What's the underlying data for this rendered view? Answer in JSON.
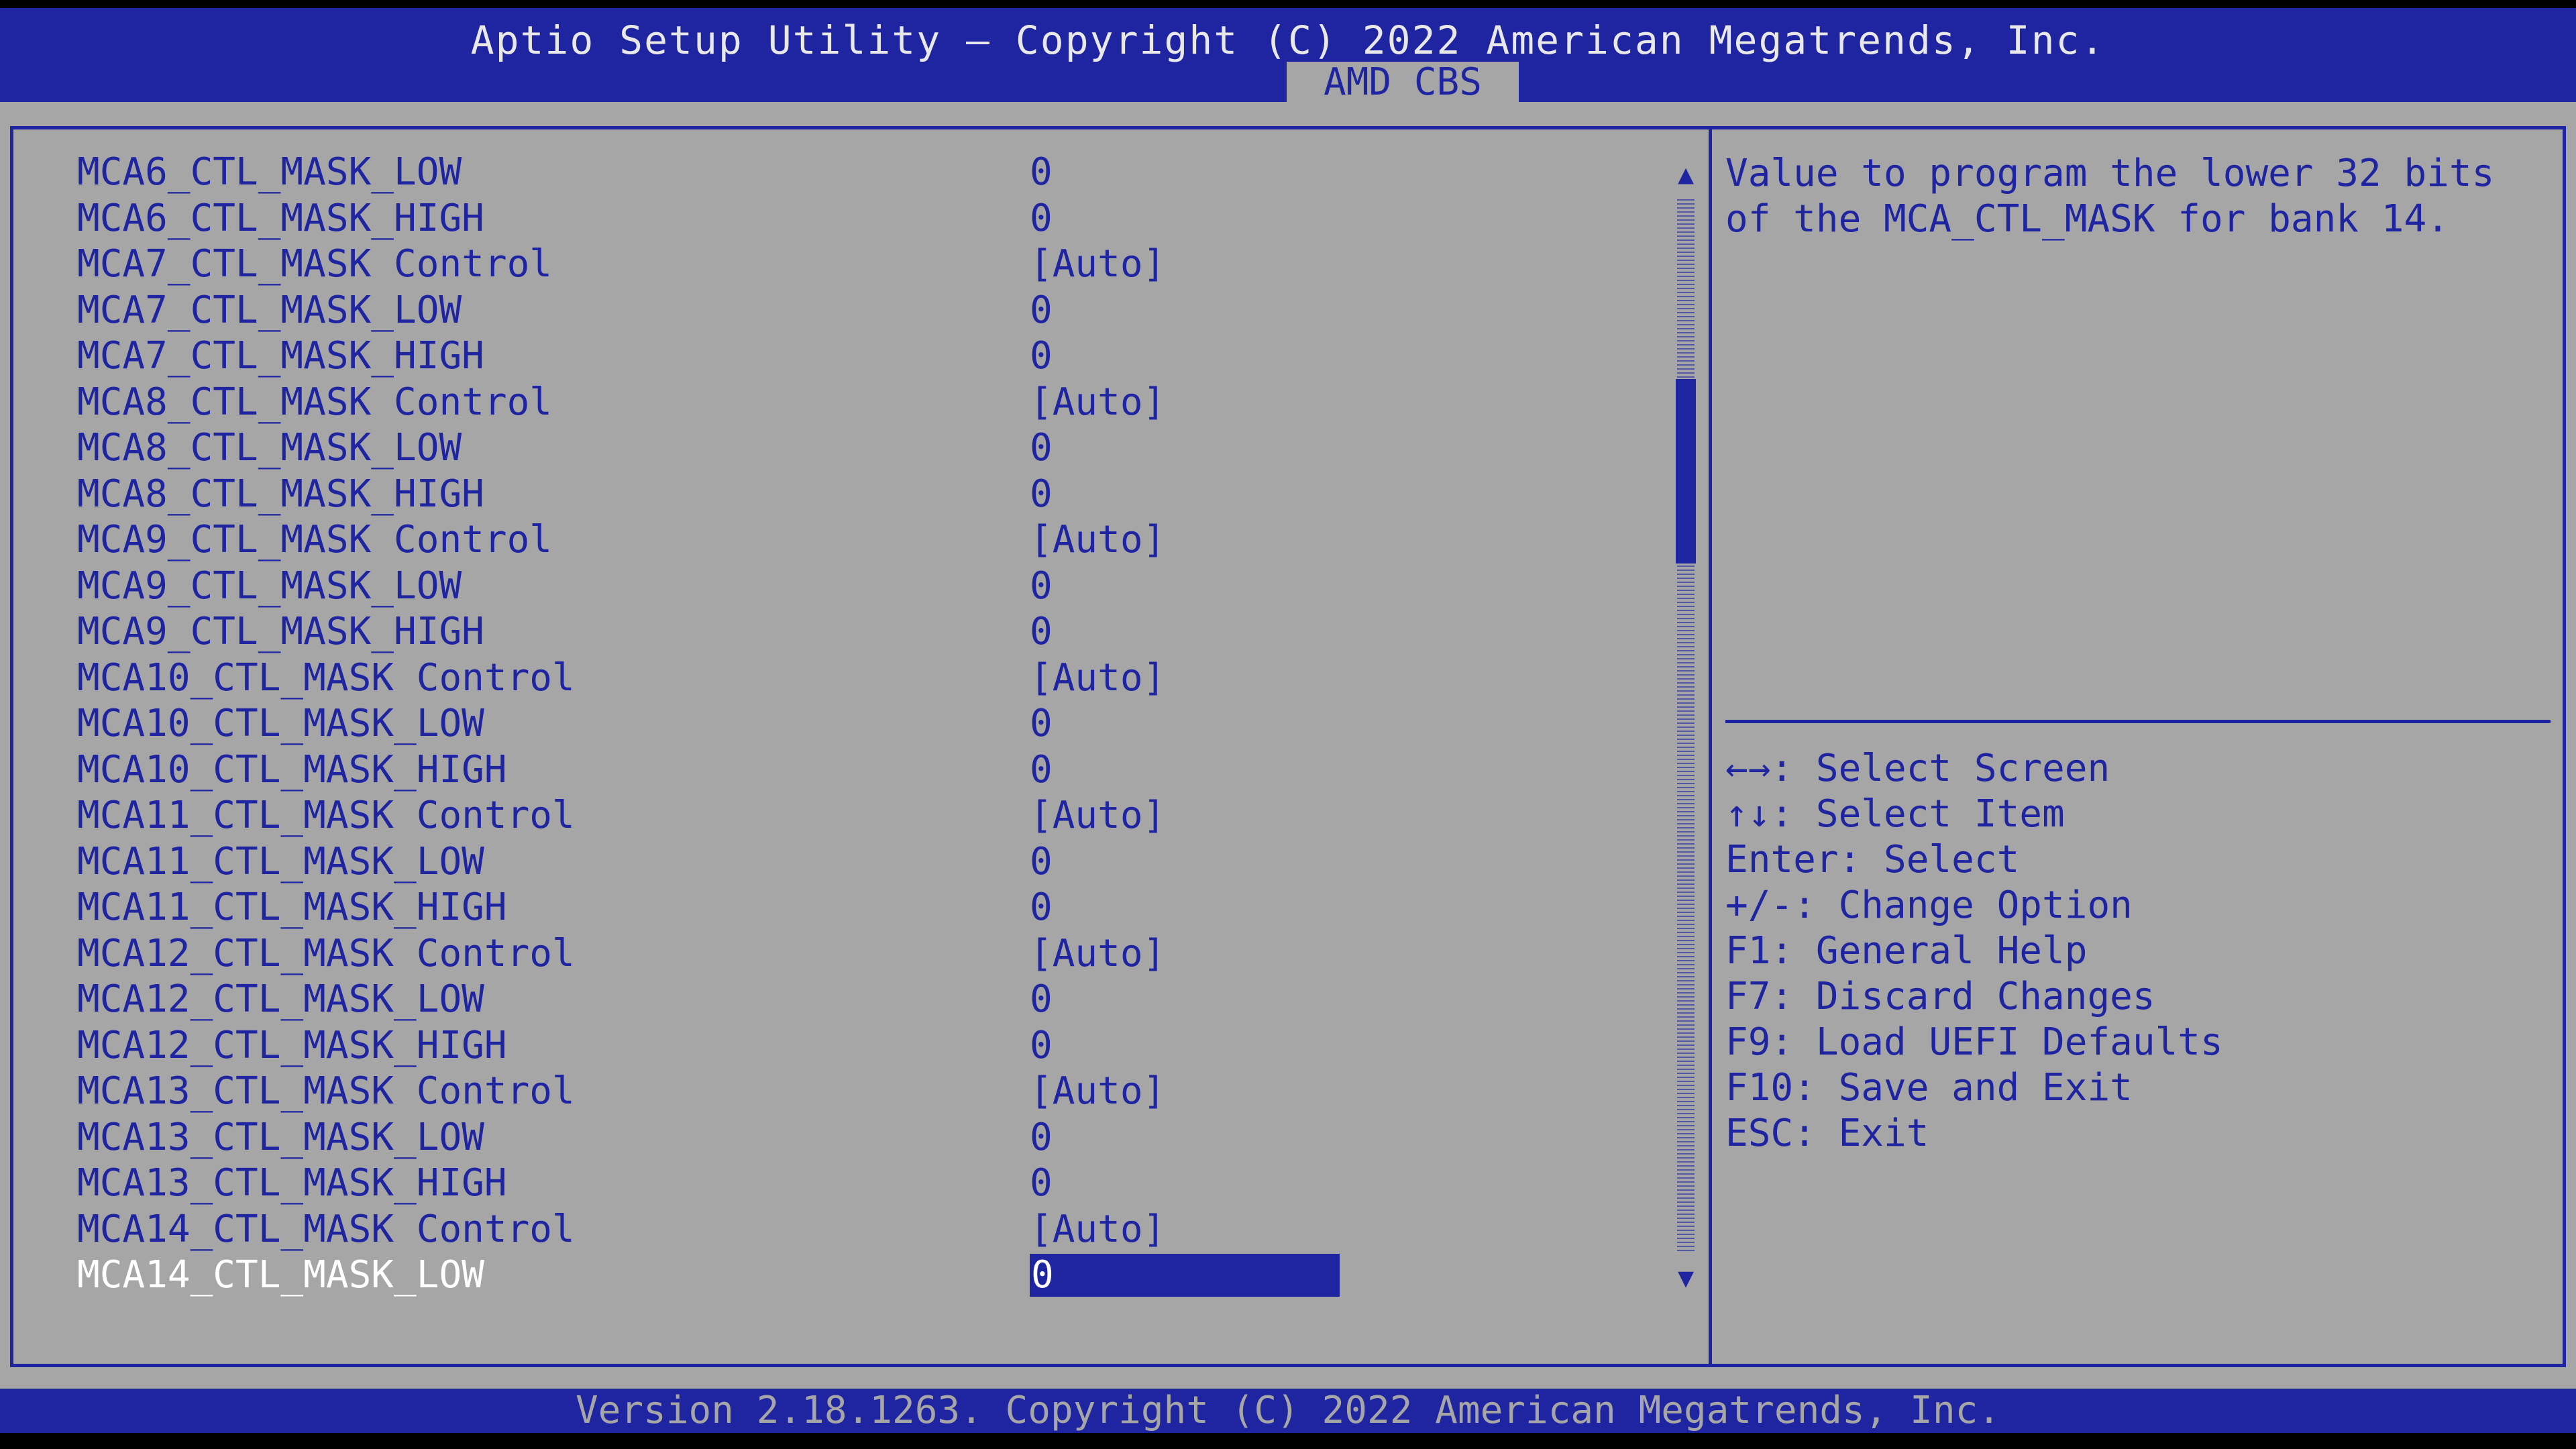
{
  "header": {
    "title": "Aptio Setup Utility – Copyright (C) 2022 American Megatrends, Inc.",
    "active_tab": "AMD CBS"
  },
  "settings": [
    {
      "label": "MCA6_CTL_MASK_LOW",
      "value": "0"
    },
    {
      "label": "MCA6_CTL_MASK_HIGH",
      "value": "0"
    },
    {
      "label": "MCA7_CTL_MASK Control",
      "value": "[Auto]"
    },
    {
      "label": "MCA7_CTL_MASK_LOW",
      "value": "0"
    },
    {
      "label": "MCA7_CTL_MASK_HIGH",
      "value": "0"
    },
    {
      "label": "MCA8_CTL_MASK Control",
      "value": "[Auto]"
    },
    {
      "label": "MCA8_CTL_MASK_LOW",
      "value": "0"
    },
    {
      "label": "MCA8_CTL_MASK_HIGH",
      "value": "0"
    },
    {
      "label": "MCA9_CTL_MASK Control",
      "value": "[Auto]"
    },
    {
      "label": "MCA9_CTL_MASK_LOW",
      "value": "0"
    },
    {
      "label": "MCA9_CTL_MASK_HIGH",
      "value": "0"
    },
    {
      "label": "MCA10_CTL_MASK Control",
      "value": "[Auto]"
    },
    {
      "label": "MCA10_CTL_MASK_LOW",
      "value": "0"
    },
    {
      "label": "MCA10_CTL_MASK_HIGH",
      "value": "0"
    },
    {
      "label": "MCA11_CTL_MASK Control",
      "value": "[Auto]"
    },
    {
      "label": "MCA11_CTL_MASK_LOW",
      "value": "0"
    },
    {
      "label": "MCA11_CTL_MASK_HIGH",
      "value": "0"
    },
    {
      "label": "MCA12_CTL_MASK Control",
      "value": "[Auto]"
    },
    {
      "label": "MCA12_CTL_MASK_LOW",
      "value": "0"
    },
    {
      "label": "MCA12_CTL_MASK_HIGH",
      "value": "0"
    },
    {
      "label": "MCA13_CTL_MASK Control",
      "value": "[Auto]"
    },
    {
      "label": "MCA13_CTL_MASK_LOW",
      "value": "0"
    },
    {
      "label": "MCA13_CTL_MASK_HIGH",
      "value": "0"
    },
    {
      "label": "MCA14_CTL_MASK Control",
      "value": "[Auto]"
    },
    {
      "label": "MCA14_CTL_MASK_LOW",
      "value": "0",
      "selected": true
    }
  ],
  "scrollbar": {
    "up_arrow": "▲",
    "down_arrow": "▼"
  },
  "help_text": "Value to program the lower 32 bits of the MCA_CTL_MASK for bank 14.",
  "key_help": [
    "←→: Select Screen",
    "↑↓: Select Item",
    "Enter: Select",
    "+/-: Change Option",
    "F1: General Help",
    "F7: Discard Changes",
    "F9: Load UEFI Defaults",
    "F10: Save and Exit",
    "ESC: Exit"
  ],
  "footer": {
    "version": "Version 2.18.1263. Copyright (C) 2022 American Megatrends, Inc."
  },
  "colors": {
    "bios_blue": "#1f24a0",
    "panel_gray": "#a6a6a6",
    "highlight_text": "#ffffff"
  }
}
